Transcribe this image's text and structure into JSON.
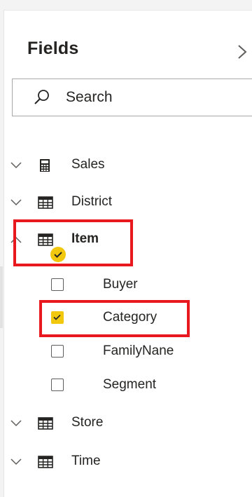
{
  "panel": {
    "title": "Fields",
    "collapse_icon": "chevron-right-icon"
  },
  "search": {
    "placeholder": "Search",
    "icon": "search-icon"
  },
  "tables": [
    {
      "name": "Sales",
      "icon": "calculator-icon",
      "expanded": false
    },
    {
      "name": "District",
      "icon": "table-icon",
      "expanded": false
    },
    {
      "name": "Item",
      "icon": "table-icon",
      "expanded": true,
      "has_selection": true
    },
    {
      "name": "Store",
      "icon": "table-icon",
      "expanded": false
    },
    {
      "name": "Time",
      "icon": "table-icon",
      "expanded": false
    }
  ],
  "item_fields": [
    {
      "name": "Buyer",
      "checked": false
    },
    {
      "name": "Category",
      "checked": true
    },
    {
      "name": "FamilyNane",
      "checked": false
    },
    {
      "name": "Segment",
      "checked": false
    }
  ],
  "colors": {
    "accent": "#f2c80f",
    "highlight": "#e8181e",
    "text": "#252423"
  }
}
